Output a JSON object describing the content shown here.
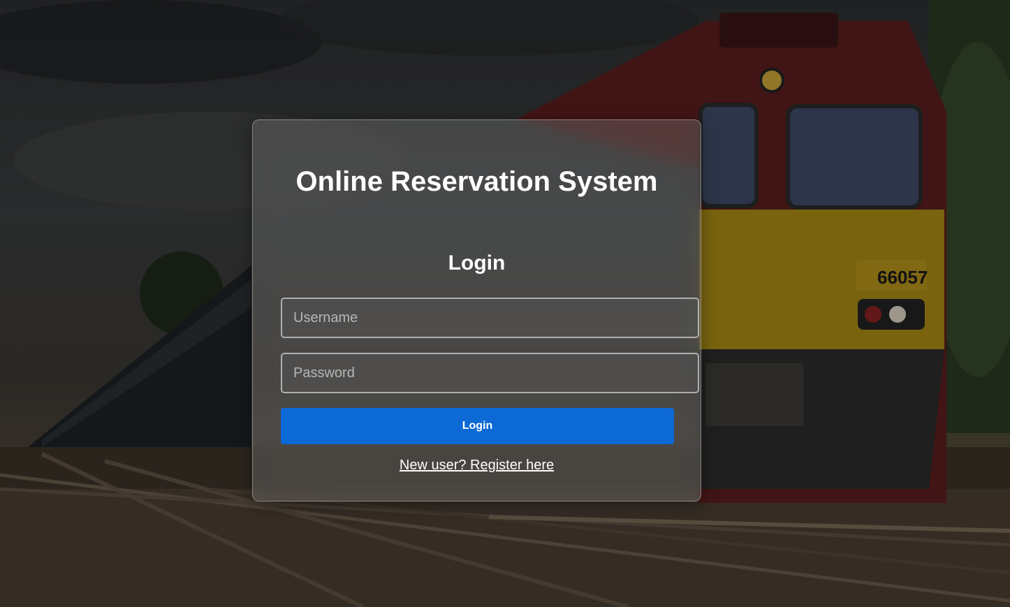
{
  "app": {
    "title": "Online Reservation System"
  },
  "login": {
    "heading": "Login",
    "username_placeholder": "Username",
    "username_value": "",
    "password_placeholder": "Password",
    "password_value": "",
    "submit_label": "Login",
    "register_link": "New user? Register here"
  },
  "background": {
    "locomotive_number": "66057"
  },
  "colors": {
    "accent": "#0c69d6",
    "text": "#ffffff"
  }
}
